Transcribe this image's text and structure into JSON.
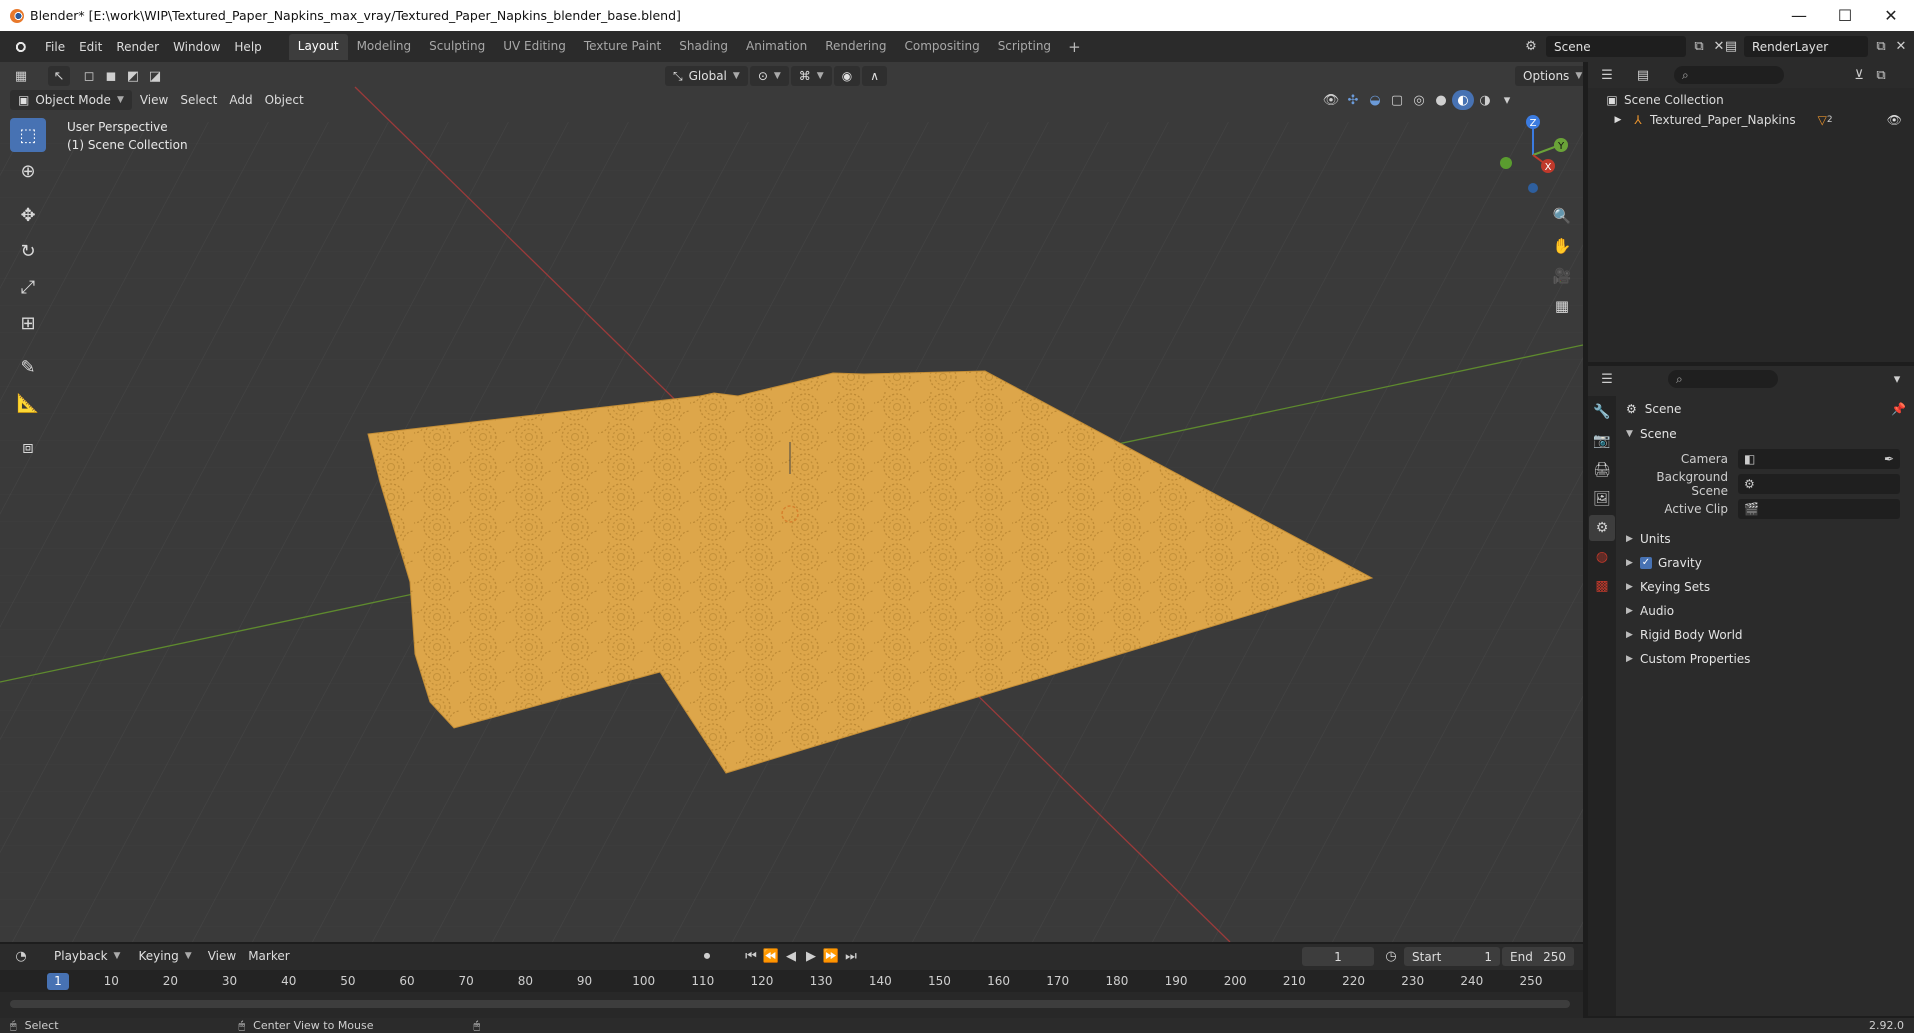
{
  "window": {
    "title": "Blender* [E:\\work\\WIP\\Textured_Paper_Napkins_max_vray/Textured_Paper_Napkins_blender_base.blend]",
    "minimize": "—",
    "maximize": "☐",
    "close": "✕"
  },
  "menu": [
    "File",
    "Edit",
    "Render",
    "Window",
    "Help"
  ],
  "workspaces": [
    {
      "label": "Layout",
      "active": true
    },
    {
      "label": "Modeling"
    },
    {
      "label": "Sculpting"
    },
    {
      "label": "UV Editing"
    },
    {
      "label": "Texture Paint"
    },
    {
      "label": "Shading"
    },
    {
      "label": "Animation"
    },
    {
      "label": "Rendering"
    },
    {
      "label": "Compositing"
    },
    {
      "label": "Scripting"
    }
  ],
  "add_workspace": "+",
  "scene_selector": "Scene",
  "view_layer_selector": "RenderLayer",
  "viewport": {
    "mode": "Object Mode",
    "menus": [
      "View",
      "Select",
      "Add",
      "Object"
    ],
    "orientation": "Global",
    "options": "Options",
    "perspective_label": "User Perspective",
    "collection_label": "(1) Scene Collection",
    "gizmo_axes": {
      "z": "Z",
      "y": "Y",
      "x": "X"
    },
    "floor_color": "#3a3a3a",
    "napkin_color": "#e0a94a"
  },
  "outliner": {
    "root": "Scene Collection",
    "items": [
      {
        "label": "Textured_Paper_Napkins",
        "badge": "2"
      }
    ]
  },
  "properties": {
    "breadcrumb": "Scene",
    "panel": "Scene",
    "fields": [
      {
        "label": "Camera",
        "value": ""
      },
      {
        "label": "Background Scene",
        "value": ""
      },
      {
        "label": "Active Clip",
        "value": ""
      }
    ],
    "subpanels": {
      "units": "Units",
      "gravity": "Gravity",
      "keying_sets": "Keying Sets",
      "audio": "Audio",
      "rigid_body_world": "Rigid Body World",
      "custom_properties": "Custom Properties"
    },
    "gravity_checked": true
  },
  "timeline": {
    "menus": [
      "Playback",
      "Keying",
      "View",
      "Marker"
    ],
    "current_frame": "1",
    "start_label": "Start",
    "start": "1",
    "end_label": "End",
    "end": "250",
    "ruler": [
      "1",
      "10",
      "20",
      "30",
      "40",
      "50",
      "60",
      "70",
      "80",
      "90",
      "100",
      "110",
      "120",
      "130",
      "140",
      "150",
      "160",
      "170",
      "180",
      "190",
      "200",
      "210",
      "220",
      "230",
      "240",
      "250"
    ]
  },
  "statusbar": {
    "left": "Select",
    "middle": "Center View to Mouse",
    "version": "2.92.0"
  },
  "colors": {
    "accent": "#4772b3",
    "x_axis": "#c0392b",
    "y_axis": "#6aa338",
    "z_axis": "#3b7be0"
  }
}
